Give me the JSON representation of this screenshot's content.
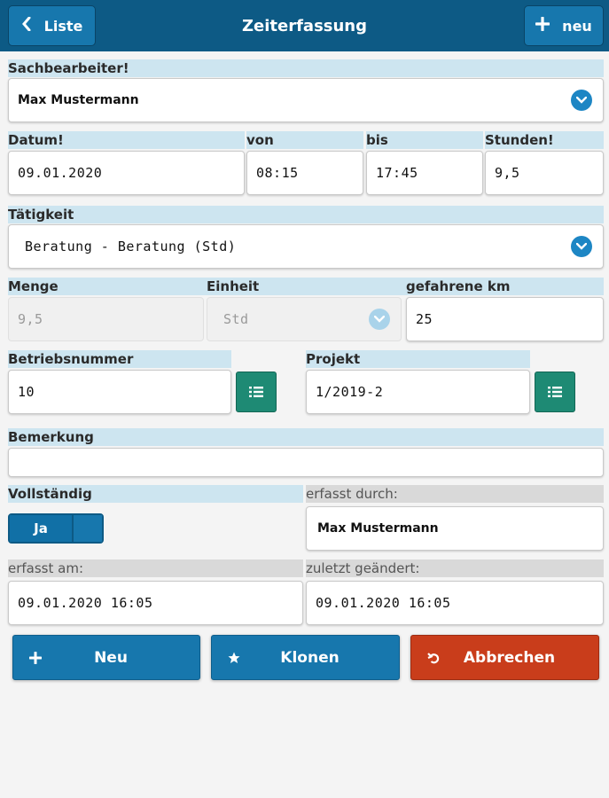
{
  "header": {
    "title": "Zeiterfassung",
    "back_label": "Liste",
    "new_label": "neu"
  },
  "sachbearbeiter": {
    "label": "Sachbearbeiter!",
    "value": "Max Mustermann"
  },
  "datum": {
    "label": "Datum!",
    "value": "09.01.2020"
  },
  "von": {
    "label": "von",
    "value": "08:15"
  },
  "bis": {
    "label": "bis",
    "value": "17:45"
  },
  "stunden": {
    "label": "Stunden!",
    "value": "9,5"
  },
  "taetigkeit": {
    "label": "Tätigkeit",
    "value": "Beratung - Beratung (Std)"
  },
  "menge": {
    "label": "Menge",
    "value": "9,5"
  },
  "einheit": {
    "label": "Einheit",
    "value": "Std"
  },
  "km": {
    "label": "gefahrene km",
    "value": "25"
  },
  "betriebsnummer": {
    "label": "Betriebsnummer",
    "value": "10"
  },
  "projekt": {
    "label": "Projekt",
    "value": "1/2019-2"
  },
  "bemerkung": {
    "label": "Bemerkung",
    "value": ""
  },
  "vollstaendig": {
    "label": "Vollständig",
    "value": "Ja"
  },
  "erfasst_durch": {
    "label": "erfasst durch:",
    "value": "Max Mustermann"
  },
  "erfasst_am": {
    "label": "erfasst am:",
    "value": "09.01.2020 16:05"
  },
  "zuletzt_geaendert": {
    "label": "zuletzt geändert:",
    "value": "09.01.2020 16:05"
  },
  "actions": {
    "neu": "Neu",
    "klonen": "Klonen",
    "abbrechen": "Abbrechen"
  },
  "colors": {
    "header": "#0d5a85",
    "accent": "#1777ad",
    "label_bg": "#cde5f0",
    "list_button": "#1e8a74",
    "cancel": "#c93d1b"
  }
}
